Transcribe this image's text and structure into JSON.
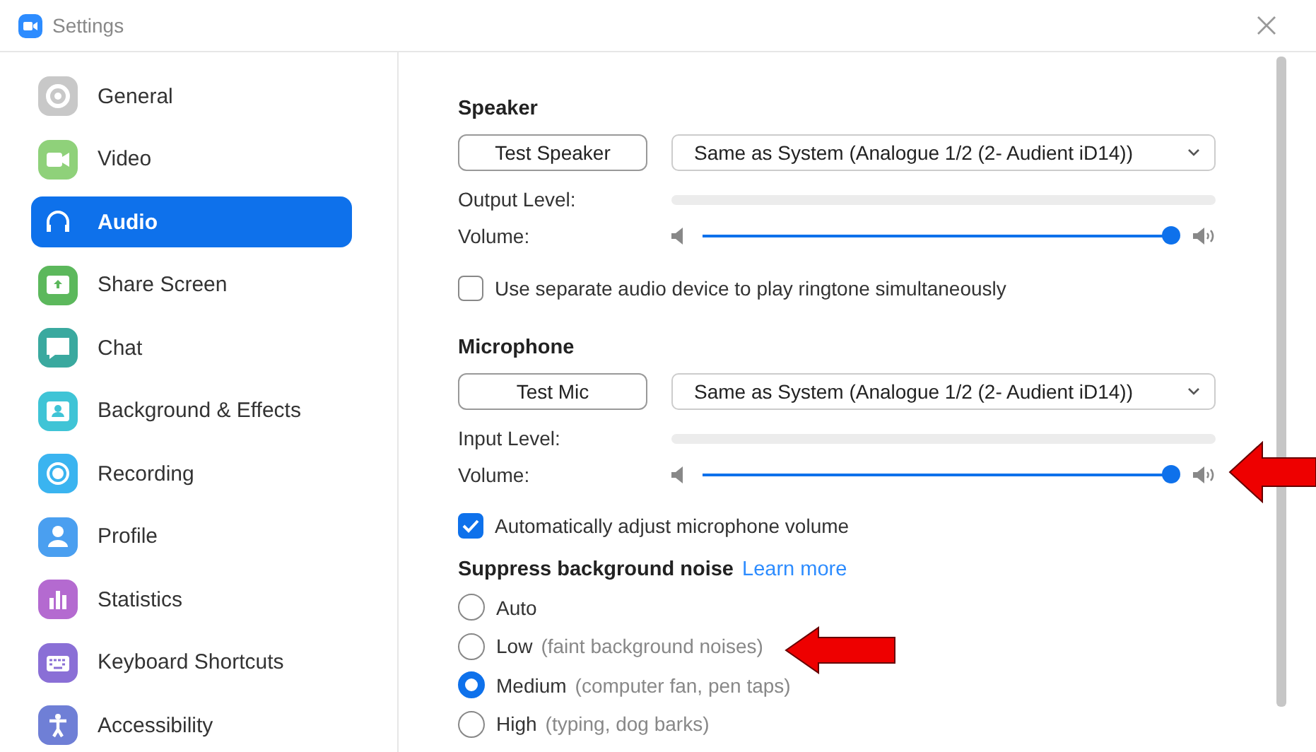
{
  "window": {
    "title": "Settings"
  },
  "sidebar": {
    "items": [
      {
        "label": "General",
        "kind": "gear",
        "selected": false
      },
      {
        "label": "Video",
        "kind": "camera",
        "selected": false
      },
      {
        "label": "Audio",
        "kind": "headphones",
        "selected": true
      },
      {
        "label": "Share Screen",
        "kind": "share",
        "selected": false
      },
      {
        "label": "Chat",
        "kind": "chat",
        "selected": false
      },
      {
        "label": "Background & Effects",
        "kind": "background",
        "selected": false
      },
      {
        "label": "Recording",
        "kind": "record",
        "selected": false
      },
      {
        "label": "Profile",
        "kind": "profile",
        "selected": false
      },
      {
        "label": "Statistics",
        "kind": "stats",
        "selected": false
      },
      {
        "label": "Keyboard Shortcuts",
        "kind": "keyboard",
        "selected": false
      },
      {
        "label": "Accessibility",
        "kind": "accessibility",
        "selected": false
      }
    ]
  },
  "speaker": {
    "heading": "Speaker",
    "test_button": "Test Speaker",
    "device": "Same as System (Analogue 1/2 (2- Audient iD14))",
    "level_label": "Output Level:",
    "level": 0,
    "volume_label": "Volume:",
    "volume": {
      "level": 1
    }
  },
  "ringtone_checkbox": {
    "label": "Use separate audio device to play ringtone simultaneously",
    "checked": false
  },
  "microphone": {
    "heading": "Microphone",
    "test_button": "Test Mic",
    "device": "Same as System (Analogue 1/2 (2- Audient iD14))",
    "level_label": "Input Level:",
    "level": 0,
    "volume_label": "Volume:",
    "volume": {
      "level": 1
    }
  },
  "auto_adjust_checkbox": {
    "label": "Automatically adjust microphone volume",
    "checked": true
  },
  "noise_suppression": {
    "heading": "Suppress background noise",
    "link": "Learn more",
    "options": [
      {
        "label": "Auto",
        "selected": false
      },
      {
        "label": "Low",
        "detail": "(faint background noises)",
        "selected": false
      },
      {
        "label": "Medium",
        "detail": "(computer fan, pen taps)",
        "selected": true
      },
      {
        "label": "High",
        "detail": "(typing, dog barks)",
        "selected": false
      }
    ]
  }
}
